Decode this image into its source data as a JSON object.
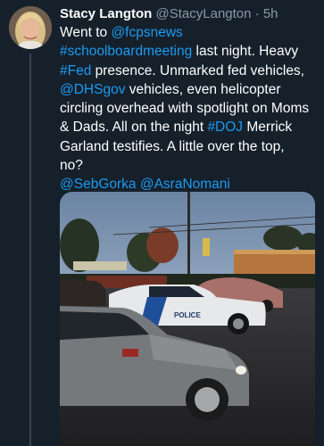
{
  "tweet": {
    "author_name": "Stacy Langton",
    "handle": "@StacyLangton",
    "separator": "·",
    "time": "5h",
    "lines": [
      [
        {
          "t": "Went to ",
          "link": false
        },
        {
          "t": "@fcpsnews",
          "link": true
        }
      ],
      [
        {
          "t": "#schoolboardmeeting",
          "link": true
        },
        {
          "t": " last night. Heavy",
          "link": false
        }
      ],
      [
        {
          "t": "#Fed",
          "link": true
        },
        {
          "t": " presence. Unmarked fed vehicles,",
          "link": false
        }
      ],
      [
        {
          "t": "@DHSgov",
          "link": true
        },
        {
          "t": " vehicles, even helicopter",
          "link": false
        }
      ],
      [
        {
          "t": "circling overhead with spotlight on Moms",
          "link": false
        }
      ],
      [
        {
          "t": "& Dads. All on the night ",
          "link": false
        },
        {
          "t": "#DOJ",
          "link": true
        },
        {
          "t": " Merrick",
          "link": false
        }
      ],
      [
        {
          "t": "Garland testifies. A little over the top,",
          "link": false
        }
      ],
      [
        {
          "t": "no?",
          "link": false
        }
      ],
      [
        {
          "t": "@SebGorka",
          "link": true
        },
        {
          "t": " ",
          "link": false
        },
        {
          "t": "@AsraNomani",
          "link": true
        }
      ]
    ],
    "photo": {
      "police_text": "POLICE",
      "description_icon": "parking-lot-photo"
    }
  },
  "colors": {
    "background": "#15202b",
    "link": "#1d9bf0",
    "muted": "#8b98a5"
  }
}
